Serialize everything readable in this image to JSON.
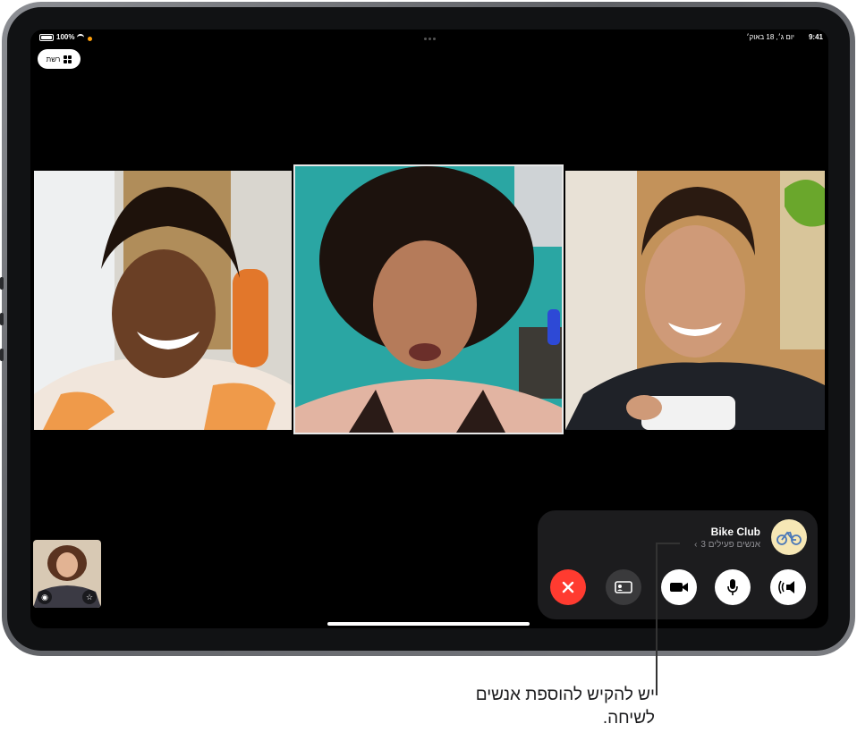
{
  "status_bar": {
    "time": "9:41",
    "date": "יום ג׳, 18 באוק׳",
    "battery": "100%"
  },
  "grid_button": {
    "label": "רשת"
  },
  "call_panel": {
    "group_name": "Bike Club",
    "participants_label": "3 אנשים פעילים",
    "avatar_icon": "bicycle-icon",
    "buttons": [
      "end-call",
      "share-screen",
      "camera",
      "microphone",
      "audio-output"
    ]
  },
  "tiles": [
    {
      "name": "participant-left",
      "active": false
    },
    {
      "name": "participant-center",
      "active": true
    },
    {
      "name": "participant-right",
      "active": false
    }
  ],
  "callout": {
    "text": "יש להקיש להוספת אנשים לשיחה."
  },
  "colors": {
    "end_call": "#ff3b30",
    "panel": "#1c1c1e",
    "screen_bg": "#000000"
  }
}
